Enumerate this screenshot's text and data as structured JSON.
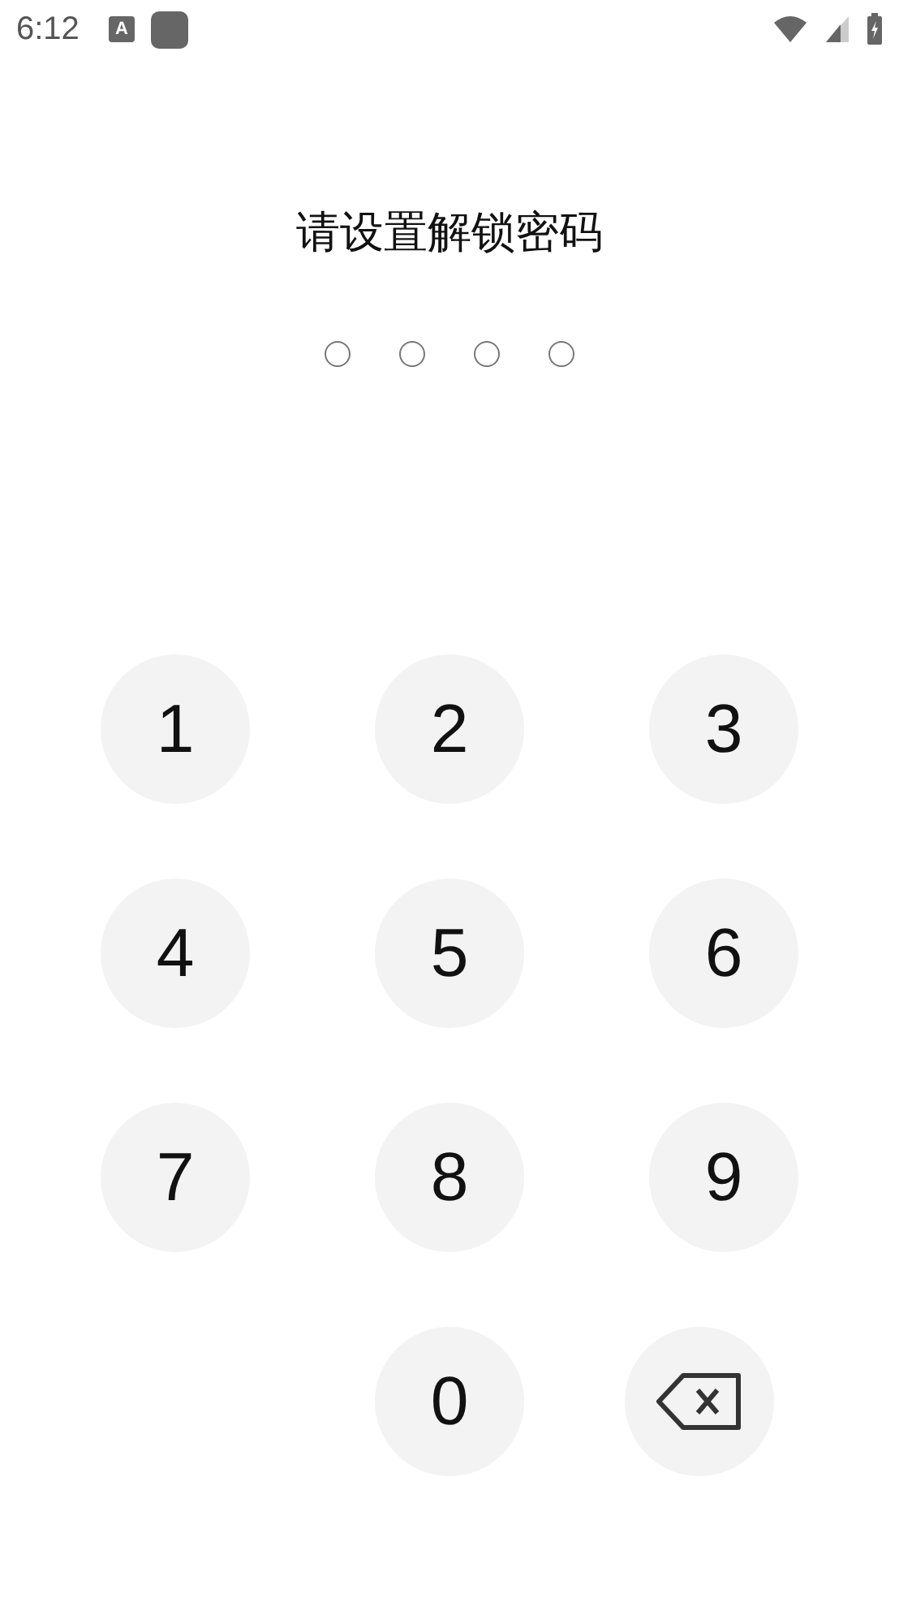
{
  "status_bar": {
    "time": "6:12",
    "input_icon_letter": "A"
  },
  "title": "请设置解锁密码",
  "pin_dots": [
    {
      "filled": false
    },
    {
      "filled": false
    },
    {
      "filled": false
    },
    {
      "filled": false
    }
  ],
  "keypad": [
    {
      "kind": "digit",
      "label": "1"
    },
    {
      "kind": "digit",
      "label": "2"
    },
    {
      "kind": "digit",
      "label": "3"
    },
    {
      "kind": "digit",
      "label": "4"
    },
    {
      "kind": "digit",
      "label": "5"
    },
    {
      "kind": "digit",
      "label": "6"
    },
    {
      "kind": "digit",
      "label": "7"
    },
    {
      "kind": "digit",
      "label": "8"
    },
    {
      "kind": "digit",
      "label": "9"
    },
    {
      "kind": "empty"
    },
    {
      "kind": "digit",
      "label": "0"
    },
    {
      "kind": "backspace"
    }
  ]
}
